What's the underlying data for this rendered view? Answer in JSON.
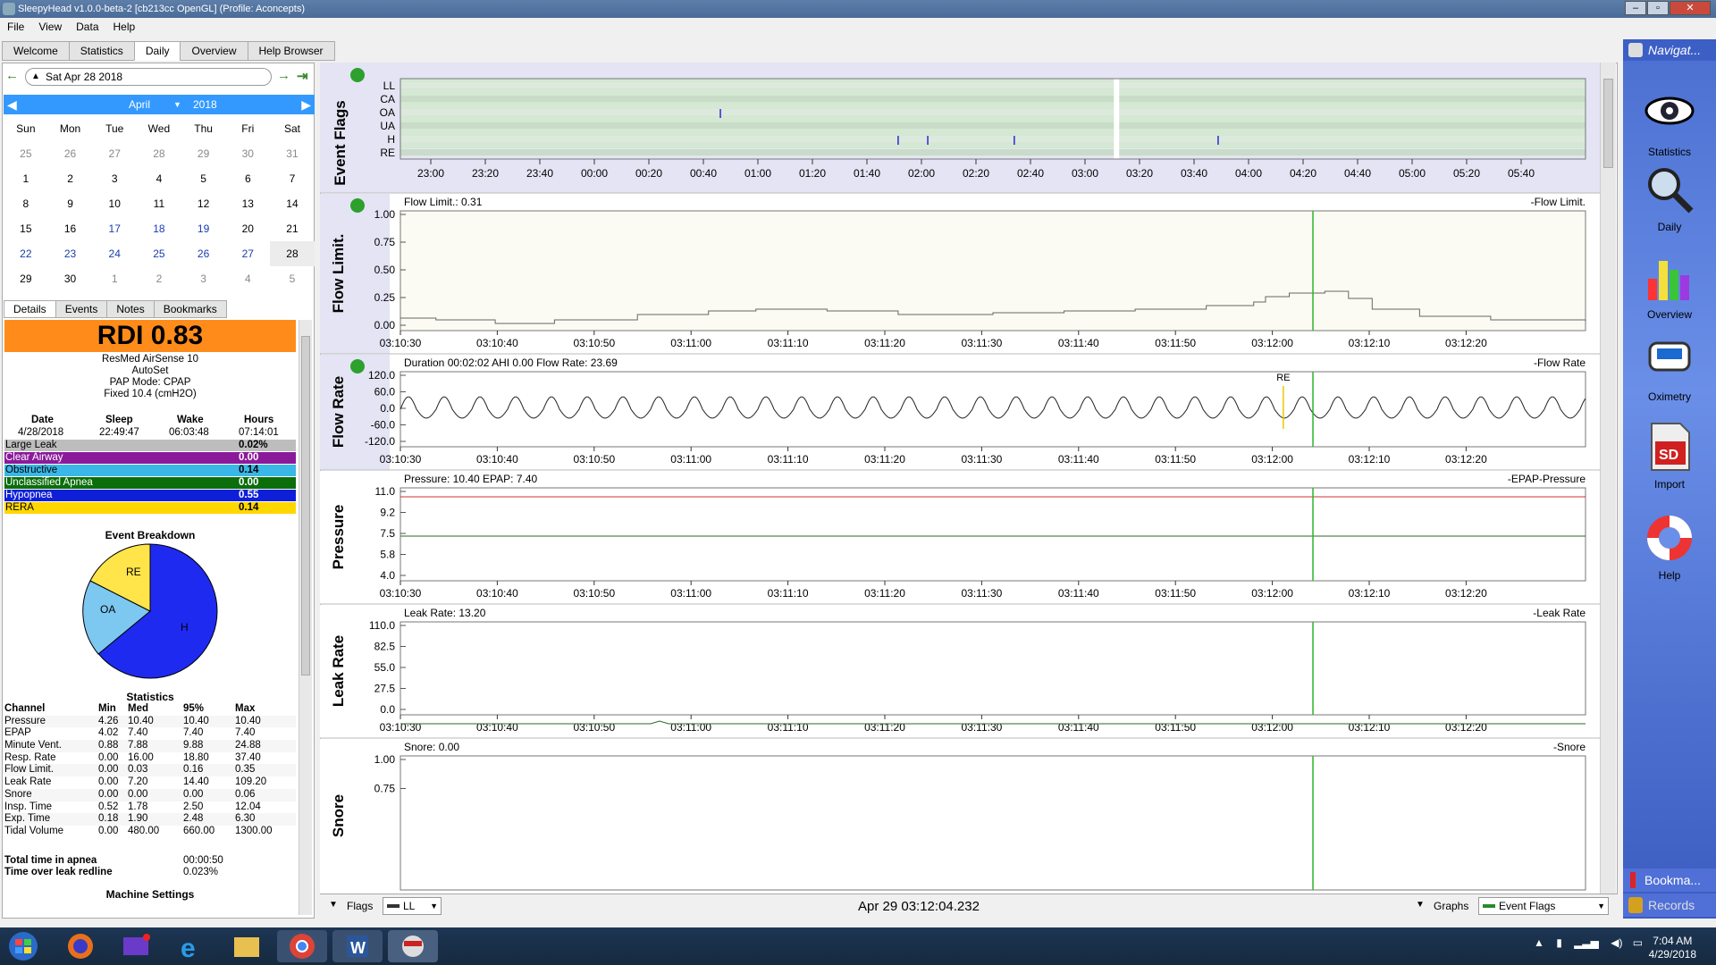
{
  "window": {
    "title": "SleepyHead v1.0.0-beta-2 [cb213cc OpenGL] (Profile: Aconcepts)",
    "buttons": [
      "–",
      "▫",
      "✕"
    ]
  },
  "menu": [
    "File",
    "View",
    "Data",
    "Help"
  ],
  "tabs": [
    "Welcome",
    "Statistics",
    "Daily",
    "Overview",
    "Help Browser"
  ],
  "date_selector": {
    "value": "Sat Apr 28 2018"
  },
  "calendar": {
    "month": "April",
    "year": "2018",
    "weekdays": [
      "Sun",
      "Mon",
      "Tue",
      "Wed",
      "Thu",
      "Fri",
      "Sat"
    ],
    "rows": [
      [
        "25",
        "26",
        "27",
        "28",
        "29",
        "30",
        "31"
      ],
      [
        "1",
        "2",
        "3",
        "4",
        "5",
        "6",
        "7"
      ],
      [
        "8",
        "9",
        "10",
        "11",
        "12",
        "13",
        "14"
      ],
      [
        "15",
        "16",
        "17",
        "18",
        "19",
        "20",
        "21"
      ],
      [
        "22",
        "23",
        "24",
        "25",
        "26",
        "27",
        "28"
      ],
      [
        "29",
        "30",
        "1",
        "2",
        "3",
        "4",
        "5"
      ]
    ]
  },
  "subtabs": [
    "Details",
    "Events",
    "Notes",
    "Bookmarks"
  ],
  "details": {
    "rdi": "RDI 0.83",
    "machine": "ResMed AirSense 10",
    "mode1": "AutoSet",
    "mode2": "PAP Mode: CPAP",
    "fixed": "Fixed 10.4 (cmH2O)",
    "session_headers": [
      "Date",
      "Sleep",
      "Wake",
      "Hours"
    ],
    "session_values": [
      "4/28/2018",
      "22:49:47",
      "06:03:48",
      "07:14:01"
    ],
    "events": [
      {
        "name": "Large Leak",
        "value": "0.02%",
        "bg": "#bdbdbd",
        "fg": "#000000"
      },
      {
        "name": "Clear Airway",
        "value": "0.00",
        "bg": "#8b1a9b",
        "fg": "#ffffff"
      },
      {
        "name": "Obstructive",
        "value": "0.14",
        "bg": "#3ab7e6",
        "fg": "#000000"
      },
      {
        "name": "Unclassified Apnea",
        "value": "0.00",
        "bg": "#0b6e0b",
        "fg": "#ffffff"
      },
      {
        "name": "Hypopnea",
        "value": "0.55",
        "bg": "#0f1fd8",
        "fg": "#ffffff"
      },
      {
        "name": "RERA",
        "value": "0.14",
        "bg": "#ffd700",
        "fg": "#000000"
      }
    ],
    "pie_title": "Event Breakdown",
    "pie_labels": {
      "re": "RE",
      "oa": "OA",
      "h": "H"
    },
    "statistics_title": "Statistics",
    "stat_headers": [
      "Channel",
      "Min",
      "Med",
      "95%",
      "Max"
    ],
    "stats": [
      [
        "Pressure",
        "4.26",
        "10.40",
        "10.40",
        "10.40"
      ],
      [
        "EPAP",
        "4.02",
        "7.40",
        "7.40",
        "7.40"
      ],
      [
        "Minute Vent.",
        "0.88",
        "7.88",
        "9.88",
        "24.88"
      ],
      [
        "Resp. Rate",
        "0.00",
        "16.00",
        "18.80",
        "37.40"
      ],
      [
        "Flow Limit.",
        "0.00",
        "0.03",
        "0.16",
        "0.35"
      ],
      [
        "Leak Rate",
        "0.00",
        "7.20",
        "14.40",
        "109.20"
      ],
      [
        "Snore",
        "0.00",
        "0.00",
        "0.00",
        "0.06"
      ],
      [
        "Insp. Time",
        "0.52",
        "1.78",
        "2.50",
        "12.04"
      ],
      [
        "Exp. Time",
        "0.18",
        "1.90",
        "2.48",
        "6.30"
      ],
      [
        "Tidal Volume",
        "0.00",
        "480.00",
        "660.00",
        "1300.00"
      ]
    ],
    "total_apnea_label": "Total time in apnea",
    "total_apnea_value": "00:00:50",
    "leak_redline_label": "Time over leak redline",
    "leak_redline_value": "0.023%",
    "machine_settings": "Machine Settings"
  },
  "event_flags": {
    "label": "Event Flags",
    "rows": [
      "LL",
      "CA",
      "OA",
      "UA",
      "H",
      "RE"
    ],
    "xticks": [
      "23:00",
      "23:20",
      "23:40",
      "00:00",
      "00:20",
      "00:40",
      "01:00",
      "01:20",
      "01:40",
      "02:00",
      "02:20",
      "02:40",
      "03:00",
      "03:20",
      "03:40",
      "04:00",
      "04:20",
      "04:40",
      "05:00",
      "05:20",
      "05:40"
    ]
  },
  "graph_xticks": [
    "03:10:30",
    "03:10:40",
    "03:10:50",
    "03:11:00",
    "03:11:10",
    "03:11:20",
    "03:11:30",
    "03:11:40",
    "03:11:50",
    "03:12:00",
    "03:12:10",
    "03:12:20"
  ],
  "flow_limit": {
    "label": "Flow Limit.",
    "title": "Flow Limit.: 0.31",
    "legend": "-Flow Limit.",
    "yticks": [
      "1.00",
      "0.75",
      "0.50",
      "0.25",
      "0.00"
    ]
  },
  "flow_rate": {
    "label": "Flow Rate",
    "title": "Duration 00:02:02 AHI 0.00 Flow Rate: 23.69",
    "legend": "-Flow Rate",
    "yticks": [
      "120.0",
      "60.0",
      "0.0",
      "-60.0",
      "-120.0"
    ],
    "marker": "RE"
  },
  "pressure": {
    "label": "Pressure",
    "title": "Pressure: 10.40 EPAP: 7.40",
    "legend": "-EPAP-Pressure",
    "yticks": [
      "11.0",
      "9.2",
      "7.5",
      "5.8",
      "4.0"
    ]
  },
  "leak_rate": {
    "label": "Leak Rate",
    "title": "Leak Rate: 13.20",
    "legend": "-Leak Rate",
    "yticks": [
      "110.0",
      "82.5",
      "55.0",
      "27.5",
      "0.0"
    ]
  },
  "snore": {
    "label": "Snore",
    "title": "Snore: 0.00",
    "legend": "-Snore",
    "yticks": [
      "1.00",
      "0.75"
    ]
  },
  "bottom": {
    "flags_label": "Flags",
    "flags_select": "LL",
    "time": "Apr 29 03:12:04.232",
    "graphs_label": "Graphs",
    "graphs_select": "Event Flags"
  },
  "navigator": {
    "title": "Navigat...",
    "items": [
      "Statistics",
      "Daily",
      "Overview",
      "Oximetry",
      "Import",
      "Help"
    ],
    "bookmarks": "Bookma...",
    "records": "Records"
  },
  "taskbar": {
    "time": "7:04 AM",
    "date": "4/29/2018"
  }
}
